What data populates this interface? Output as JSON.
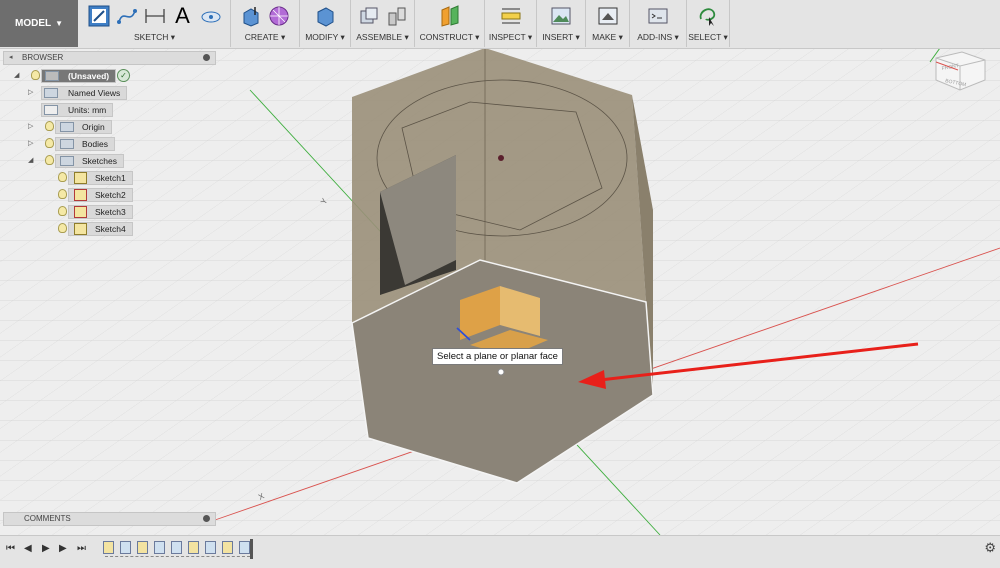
{
  "toolbar": {
    "workspace": "MODEL",
    "groups": {
      "sketch": "SKETCH",
      "create": "CREATE",
      "modify": "MODIFY",
      "assemble": "ASSEMBLE",
      "construct": "CONSTRUCT",
      "inspect": "INSPECT",
      "insert": "INSERT",
      "make": "MAKE",
      "addins": "ADD-INS",
      "select": "SELECT"
    },
    "sketch_text_glyph": "A"
  },
  "browser": {
    "title": "BROWSER",
    "root": "(Unsaved)",
    "items": {
      "named_views": "Named Views",
      "units": "Units: mm",
      "origin": "Origin",
      "bodies": "Bodies",
      "sketches": "Sketches",
      "sketch1": "Sketch1",
      "sketch2": "Sketch2",
      "sketch3": "Sketch3",
      "sketch4": "Sketch4"
    }
  },
  "viewcube": {
    "front": "FRONT",
    "bottom": "BOTTOM"
  },
  "viewport": {
    "tooltip": "Select a plane or planar face",
    "axis_label_green": "Y",
    "axis_label_red": "X",
    "colors": {
      "arrow": "#e8201a",
      "x_axis": "#d9534f",
      "y_axis": "#3fae3f",
      "profile": "#f2a93b"
    }
  },
  "comments": {
    "title": "COMMENTS"
  }
}
